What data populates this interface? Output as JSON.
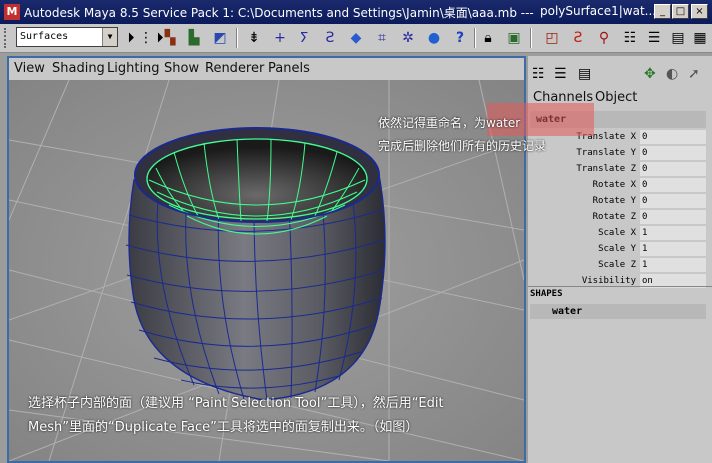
{
  "window": {
    "title": "Autodesk Maya 8.5 Service Pack 1: C:\\Documents and Settings\\Jamin\\桌面\\aaa.mb   ---   polySurface1|wat...",
    "title_main": "Autodesk Maya 8.5 Service Pack 1: C:\\Documents and Settings\\Jamin\\桌面\\aaa.mb   ---",
    "title_right": "polySurface1|wat...",
    "minimize": "_",
    "maximize": "□",
    "close": "×"
  },
  "toolbar": {
    "mode_value": "Surfaces"
  },
  "panel_menu": [
    "View",
    "Shading",
    "Lighting",
    "Show",
    "Renderer",
    "Panels"
  ],
  "channel_box": {
    "tabs": [
      "Channels",
      "Object"
    ],
    "object_name": "water",
    "attributes": [
      {
        "label": "Translate X",
        "value": "0"
      },
      {
        "label": "Translate Y",
        "value": "0"
      },
      {
        "label": "Translate Z",
        "value": "0"
      },
      {
        "label": "Rotate X",
        "value": "0"
      },
      {
        "label": "Rotate Y",
        "value": "0"
      },
      {
        "label": "Rotate Z",
        "value": "0"
      },
      {
        "label": "Scale X",
        "value": "1"
      },
      {
        "label": "Scale Y",
        "value": "1"
      },
      {
        "label": "Scale Z",
        "value": "1"
      },
      {
        "label": "Visibility",
        "value": "on"
      }
    ],
    "shapes_header": "SHAPES",
    "shape_name": "water"
  },
  "annotations": {
    "top_line1": "依然记得重命名，为water",
    "top_line2": "完成后删除他们所有的历史记录",
    "bottom_line1": "选择杯子内部的面（建议用 “Paint Selection Tool”工具），然后用“Edit",
    "bottom_line2": "Mesh”里面的“Duplicate Face”工具将选中的面复制出来。（如图）"
  },
  "colors": {
    "title_bar": "#0a1a5a",
    "viewport_border": "#3b6ca8",
    "selected_wire": "#40ff90",
    "mesh_wire": "#1a2a90",
    "highlight": "#e65a5a"
  }
}
